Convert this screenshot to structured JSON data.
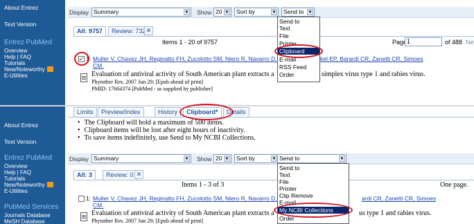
{
  "sidebar_top": {
    "about": "About Entrez",
    "text_version": "Text Version",
    "section": "Entrez PubMed",
    "links": [
      "Overview",
      "Help | FAQ",
      "Tutorials",
      "New/Noteworthy",
      "E-Utilities"
    ]
  },
  "sidebar_bottom": {
    "about": "About Entrez",
    "text_version": "Text Version",
    "section": "Entrez PubMed",
    "links": [
      "Overview",
      "Help | FAQ",
      "Tutorials",
      "New/Noteworthy",
      "E-Utilities"
    ],
    "services_section": "PubMed Services",
    "services_links": [
      "Journals Database",
      "MeSH Database"
    ]
  },
  "top": {
    "display_label": "Display",
    "display_value": "Summary",
    "show_label": "Show",
    "show_value": "20",
    "sort_value": "Sort by",
    "sendto_value": "Send to",
    "tabs": {
      "all": "All: 9757",
      "review": "Review: 732",
      "x": "✕"
    },
    "items_text": "Items 1 - 20 of 9757",
    "page_label": "Page",
    "page_value": "1",
    "of_text": "of 488",
    "next_text": "Nex",
    "result": {
      "num": "1:",
      "authors": "Muller V, Chavez JH, Reginatto FH, Zucolotto SM, Niero R, Navarro D,",
      "authors_tail": "kel EP, Barardi CR, Zanetti CR, Simoes",
      "authors_cm": "CM.",
      "title_head": "Evaluation of antiviral activity of South American plant extracts a",
      "title_tail": "simplex virus type 1 and rabies virus.",
      "journal": "Phytother Res. 2007 Jun 29; [Epub ahead of print]",
      "pmid": "PMID: 17604374 [PubMed - as supplied by publisher]"
    },
    "dropdown": [
      "Send to",
      "Text",
      "File",
      "Printer",
      "Clipboard",
      "E-mail",
      "RSS Feed",
      "Order"
    ],
    "selected": "Clipboard"
  },
  "bottom": {
    "tabs": [
      "Limits",
      "Preview/Index",
      "History",
      "Clipboard*",
      "Details"
    ],
    "bullets": [
      "The Clipboard will hold a maximum of 500 items.",
      "Clipboard items will be lost after eight hours of inactivity.",
      "To save items indefinitely, use Send to My NCBI Collections."
    ],
    "display_label": "Display",
    "display_value": "Summary",
    "show_label": "Show",
    "show_value": "20",
    "sort_value": "Sort by",
    "sendto_value": "Send to",
    "result_tabs": {
      "all": "All: 3",
      "review": "Review: 0",
      "x": "✕"
    },
    "items_text": "Items 1 - 3 of 3",
    "one_page": "One page.",
    "result": {
      "num": "1:",
      "authors": "Muller V, Chavez JH, Reginatto FH, Zucolotto SM, Niero R, Navarro D,",
      "authors_tail": "ardi CR, Zanetti CR, Simoes",
      "authors_cm": "CM.",
      "title_head": "Evaluation of antiviral activity of South American plant extracts a",
      "title_tail": "us type 1 and rabies virus.",
      "journal": "Phytother Res. 2007 Jun 29; [Epub ahead of print]"
    },
    "dropdown": [
      "Send to",
      "Text",
      "File",
      "Printer",
      "Clip Remove",
      "E-mail",
      "My NCBI Collections",
      "Order"
    ],
    "selected": "My NCBI Collections"
  },
  "colors": {
    "sidebar": "#1e5a96",
    "highlight": "#0a246a",
    "annotation_ring": "#d0141e"
  }
}
